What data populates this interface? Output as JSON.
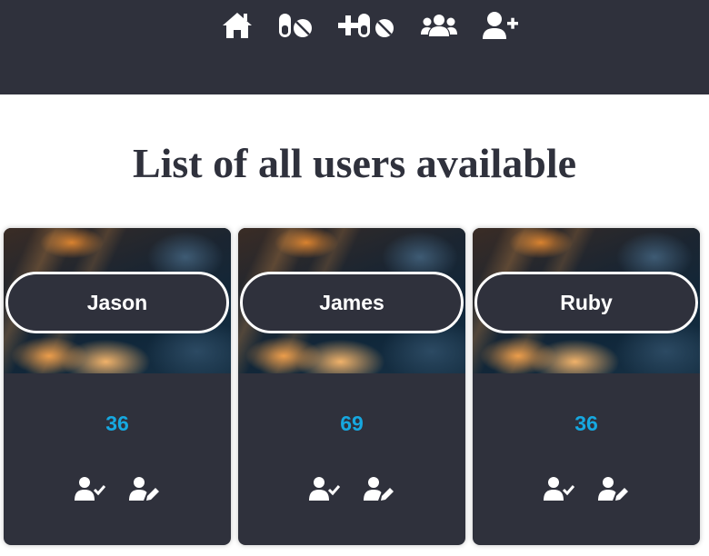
{
  "nav": {
    "items": [
      {
        "icon": "home-icon"
      },
      {
        "icon": "pills-icon"
      },
      {
        "icon": "add-pills-icon"
      },
      {
        "icon": "users-icon"
      },
      {
        "icon": "user-plus-icon"
      }
    ]
  },
  "main": {
    "title": "List of all users available"
  },
  "users": [
    {
      "name": "Jason",
      "age": "36"
    },
    {
      "name": "James",
      "age": "69"
    },
    {
      "name": "Ruby",
      "age": "36"
    }
  ],
  "card_actions": [
    {
      "icon": "user-check-icon"
    },
    {
      "icon": "user-edit-icon"
    }
  ],
  "colors": {
    "navbar": "#2f313c",
    "card": "#2f313c",
    "title": "#2f313c",
    "age": "#16a8e0",
    "pill_border": "#ffffff"
  }
}
